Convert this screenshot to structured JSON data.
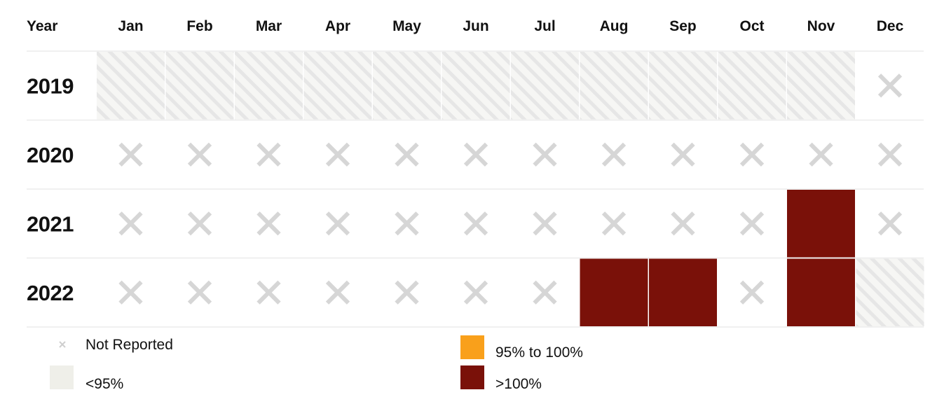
{
  "chart_data": {
    "type": "heatmap",
    "year_header": "Year",
    "months": [
      "Jan",
      "Feb",
      "Mar",
      "Apr",
      "May",
      "Jun",
      "Jul",
      "Aug",
      "Sep",
      "Oct",
      "Nov",
      "Dec"
    ],
    "years": [
      "2019",
      "2020",
      "2021",
      "2022"
    ],
    "status_grid": [
      [
        "lt95",
        "lt95",
        "lt95",
        "lt95",
        "lt95",
        "lt95",
        "lt95",
        "lt95",
        "lt95",
        "lt95",
        "lt95",
        "not_reported"
      ],
      [
        "not_reported",
        "not_reported",
        "not_reported",
        "not_reported",
        "not_reported",
        "not_reported",
        "not_reported",
        "not_reported",
        "not_reported",
        "not_reported",
        "not_reported",
        "not_reported"
      ],
      [
        "not_reported",
        "not_reported",
        "not_reported",
        "not_reported",
        "not_reported",
        "not_reported",
        "not_reported",
        "not_reported",
        "not_reported",
        "not_reported",
        "gt100",
        "not_reported"
      ],
      [
        "not_reported",
        "not_reported",
        "not_reported",
        "not_reported",
        "not_reported",
        "not_reported",
        "not_reported",
        "gt100",
        "gt100",
        "not_reported",
        "gt100",
        "lt95"
      ]
    ],
    "legend": [
      {
        "key": "not_reported",
        "label": "Not Reported",
        "color": "#d6d6d6"
      },
      {
        "key": "lt95",
        "label": "<95%",
        "color": "#efefe9"
      },
      {
        "key": "95_100",
        "label": "95% to 100%",
        "color": "#f9a01b"
      },
      {
        "key": "gt100",
        "label": ">100%",
        "color": "#7a1109"
      }
    ],
    "colors": {
      "gt100": "#7a1109",
      "95_100": "#f9a01b",
      "lt95_fill": "#f6f6f4",
      "lt95_stripe": "#e6e6e6",
      "x_mark": "#d6d6d6",
      "divider": "#ebebeb"
    }
  }
}
